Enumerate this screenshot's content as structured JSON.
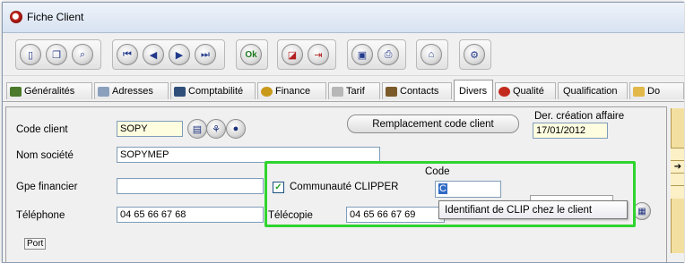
{
  "window": {
    "title": "Fiche Client"
  },
  "toolbar": {
    "ok_label": "Ok",
    "groups": [
      {
        "icons": [
          "new-doc-icon",
          "copy-doc-icon",
          "search-icon"
        ]
      },
      {
        "icons": [
          "first-record-icon",
          "previous-record-icon",
          "next-record-icon",
          "last-record-icon"
        ]
      },
      {
        "icons": [
          "validate-icon"
        ]
      },
      {
        "icons": [
          "chart-icon",
          "exit-icon"
        ]
      },
      {
        "icons": [
          "preview-icon",
          "print-icon"
        ]
      },
      {
        "icons": [
          "trash-icon"
        ]
      },
      {
        "icons": [
          "tools-icon"
        ]
      }
    ]
  },
  "tabs": [
    {
      "label": "Généralités",
      "icon": "people-icon"
    },
    {
      "label": "Adresses",
      "icon": "address-card-icon"
    },
    {
      "label": "Comptabilité",
      "icon": "ledger-icon"
    },
    {
      "label": "Finance",
      "icon": "money-icon"
    },
    {
      "label": "Tarif",
      "icon": "price-tag-icon"
    },
    {
      "label": "Contacts",
      "icon": "contact-icon"
    },
    {
      "label": "Divers",
      "active": true
    },
    {
      "label": "Qualité",
      "icon": "quality-icon"
    },
    {
      "label": "Qualification"
    },
    {
      "label": "Do",
      "icon": "folder-icon"
    }
  ],
  "form": {
    "code_client_label": "Code client",
    "code_client_value": "SOPY",
    "nom_societe_label": "Nom société",
    "nom_societe_value": "SOPYMEP",
    "gpe_financier_label": "Gpe financier",
    "gpe_financier_value": "",
    "telephone_label": "Téléphone",
    "telephone_value": "04 65 66 67 68",
    "telecopie_label": "Télécopie",
    "telecopie_value": "04 65 66 67 69",
    "communaute_label": "Communauté CLIPPER",
    "communaute_checked": true,
    "code_label": "Code",
    "code_value": "C",
    "remplacement_button": "Remplacement code client",
    "der_creation_label": "Der. création affaire",
    "der_creation_value": "17/01/2012",
    "port_label": "Port"
  },
  "tooltip": {
    "text": "Identifiant de CLIP chez le client"
  },
  "colors": {
    "highlight": "#2fd42f",
    "tooltip_bg": "#ffffff",
    "field_yellow": "#fffde0"
  }
}
